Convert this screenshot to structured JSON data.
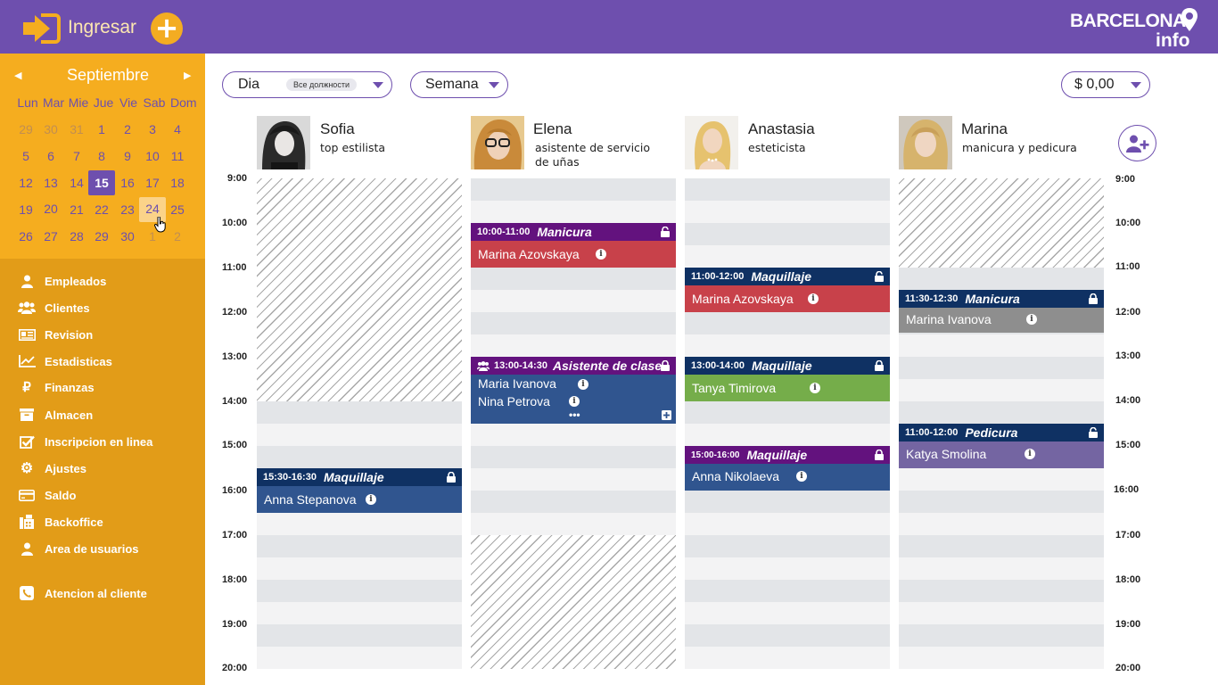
{
  "topbar": {
    "login_label": "Ingresar",
    "logo_line1": "BARCELONA",
    "logo_line2": "info",
    "add_icon": "plus-icon"
  },
  "calendar": {
    "month": "Septiembre",
    "weekdays": [
      "Lun",
      "Mar",
      "Mie",
      "Jue",
      "Vie",
      "Sab",
      "Dom"
    ],
    "weeks": [
      [
        "29",
        "30",
        "31",
        "1",
        "2",
        "3",
        "4"
      ],
      [
        "5",
        "6",
        "7",
        "8",
        "9",
        "10",
        "11"
      ],
      [
        "12",
        "13",
        "14",
        "15",
        "16",
        "17",
        "18"
      ],
      [
        "19",
        "20",
        "21",
        "22",
        "23",
        "24",
        "25"
      ],
      [
        "26",
        "27",
        "28",
        "29",
        "30",
        "1",
        "2"
      ]
    ],
    "selected_day": "15",
    "hover_day": "24"
  },
  "nav": [
    {
      "label": "Empleados",
      "icon": "person-icon"
    },
    {
      "label": "Clientes",
      "icon": "users-icon"
    },
    {
      "label": "Revision",
      "icon": "newspaper-icon"
    },
    {
      "label": "Estadisticas",
      "icon": "chart-icon"
    },
    {
      "label": "Finanzas",
      "icon": "ruble-icon"
    },
    {
      "label": "Almacen",
      "icon": "archive-icon"
    },
    {
      "label": "Inscripcion en linea",
      "icon": "checkbox-icon"
    },
    {
      "label": "Ajustes",
      "icon": "gear-icon"
    },
    {
      "label": "Saldo",
      "icon": "credit-card-icon"
    },
    {
      "label": "Backoffice",
      "icon": "fax-icon"
    },
    {
      "label": "Area de usuarios",
      "icon": "user-icon"
    },
    {
      "label": "Atencion al cliente",
      "icon": "phone-icon"
    }
  ],
  "toolbar": {
    "view_day": "Dia",
    "position_filter": "Все должности",
    "view_week": "Semana",
    "balance": "$ 0,00"
  },
  "employees": [
    {
      "name": "Sofia",
      "role": "top estilista"
    },
    {
      "name": "Elena",
      "role": "asistente de servicio de uñas"
    },
    {
      "name": "Anastasia",
      "role": "esteticista"
    },
    {
      "name": "Marina",
      "role": "manicura y pedicura"
    }
  ],
  "hours": [
    "9:00",
    "10:00",
    "11:00",
    "12:00",
    "13:00",
    "14:00",
    "15:00",
    "16:00",
    "17:00",
    "18:00",
    "19:00",
    "20:00"
  ],
  "events": {
    "sofia_1": {
      "time": "15:30-16:30",
      "service": "Maquillaje",
      "client": "Anna Stepanova"
    },
    "elena_1": {
      "time": "10:00-11:00",
      "service": "Manicura",
      "client": "Marina Azovskaya"
    },
    "elena_2": {
      "time": "13:00-14:30",
      "service": "Asistente de clase",
      "client1": "Maria Ivanova",
      "client2": "Nina Petrova"
    },
    "anastasia_1": {
      "time": "11:00-12:00",
      "service": "Maquillaje",
      "client": "Marina Azovskaya"
    },
    "anastasia_2": {
      "time": "13:00-14:00",
      "service": "Maquillaje",
      "client": "Tanya Timirova"
    },
    "anastasia_3": {
      "time": "15:00-16:00",
      "service": "Maquillaje",
      "client": "Anna Nikolaeva"
    },
    "marina_1": {
      "time": "11:30-12:30",
      "service": "Manicura",
      "client": "Marina Ivanova"
    },
    "marina_2": {
      "time": "11:00-12:00",
      "service": "Pedicura",
      "client": "Katya Smolina"
    }
  },
  "colors": {
    "brand_purple": "#6e4fae",
    "sidebar_orange": "#e29c18",
    "calendar_orange": "#f5ad1f",
    "header_navy": "#0f3163",
    "header_purple": "#63127e",
    "body_red": "#c8414a",
    "body_blue": "#30558f",
    "body_green": "#75ad4a",
    "body_gray": "#8e8e8e",
    "body_lavender": "#7465a2"
  }
}
